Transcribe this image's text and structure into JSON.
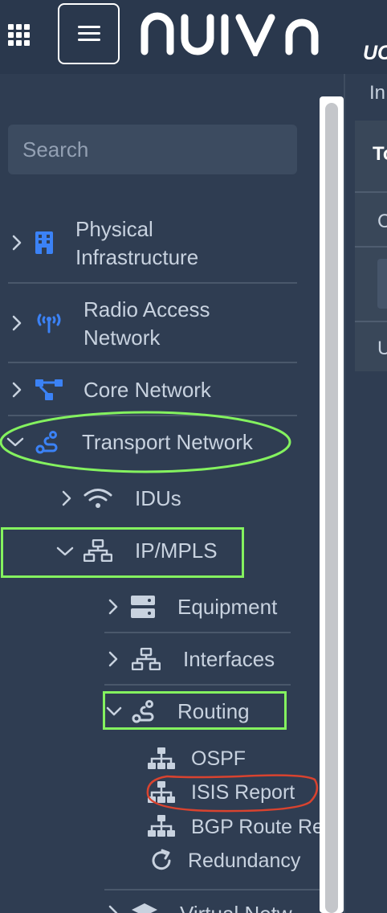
{
  "header": {
    "logo_text": "nuiva",
    "cut_title": "UC"
  },
  "search": {
    "placeholder": "Search"
  },
  "nav": {
    "physical_infrastructure": "Physical\nInfrastructure",
    "physical_line1": "Physical",
    "physical_line2": "Infrastructure",
    "ran_line1": "Radio Access",
    "ran_line2": "Network",
    "core_network": "Core Network",
    "transport_network": "Transport Network",
    "idus": "IDUs",
    "ipmpls": "IP/MPLS",
    "equipment": "Equipment",
    "interfaces": "Interfaces",
    "routing": "Routing",
    "ospf": "OSPF",
    "isis_report": "ISIS Report",
    "bgp_route": "BGP Route Re",
    "redundancy": "Redundancy",
    "virtual": "Virtual Netw"
  },
  "right_panel": {
    "breadcrumb": "In",
    "header_cell": "To",
    "row1": "C",
    "row2": "U"
  },
  "colors": {
    "accent_blue": "#3b82f6",
    "annotation_green": "#84f25f",
    "annotation_red": "#d9432f",
    "text": "#c8d2df"
  }
}
